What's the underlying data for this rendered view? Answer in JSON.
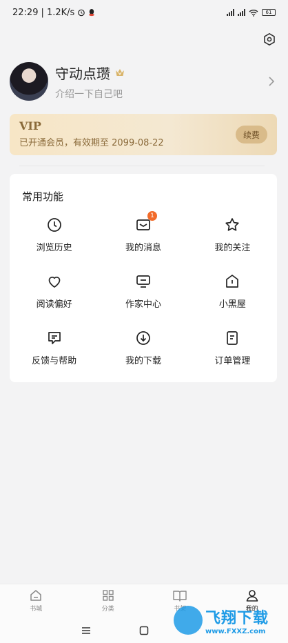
{
  "status_bar": {
    "time": "22:29",
    "speed": "| 1.2K/s",
    "battery": "61"
  },
  "profile": {
    "username": "守动点瓒",
    "bio": "介绍一下自己吧"
  },
  "vip": {
    "title": "VIP",
    "subtitle": "已开通会员，有效期至 2099-08-22",
    "renew_label": "续费"
  },
  "functions": {
    "title": "常用功能",
    "items": [
      {
        "label": "浏览历史",
        "icon": "clock-icon"
      },
      {
        "label": "我的消息",
        "icon": "message-icon",
        "badge": "1"
      },
      {
        "label": "我的关注",
        "icon": "star-icon"
      },
      {
        "label": "阅读偏好",
        "icon": "heart-icon"
      },
      {
        "label": "作家中心",
        "icon": "monitor-icon"
      },
      {
        "label": "小黑屋",
        "icon": "house-icon"
      },
      {
        "label": "反馈与帮助",
        "icon": "feedback-icon"
      },
      {
        "label": "我的下载",
        "icon": "download-icon"
      },
      {
        "label": "订单管理",
        "icon": "order-icon"
      }
    ]
  },
  "tabs": [
    {
      "label": "书城",
      "icon": "bookstore-icon"
    },
    {
      "label": "分类",
      "icon": "category-icon"
    },
    {
      "label": "书架",
      "icon": "book-icon"
    },
    {
      "label": "我的",
      "icon": "user-icon"
    }
  ],
  "watermark": {
    "title": "飞翔下载",
    "url": "www.FXXZ.com"
  },
  "colors": {
    "accent_gold": "#8a6a3a",
    "badge": "#f26b2a",
    "watermark_blue": "#1e9be6"
  }
}
